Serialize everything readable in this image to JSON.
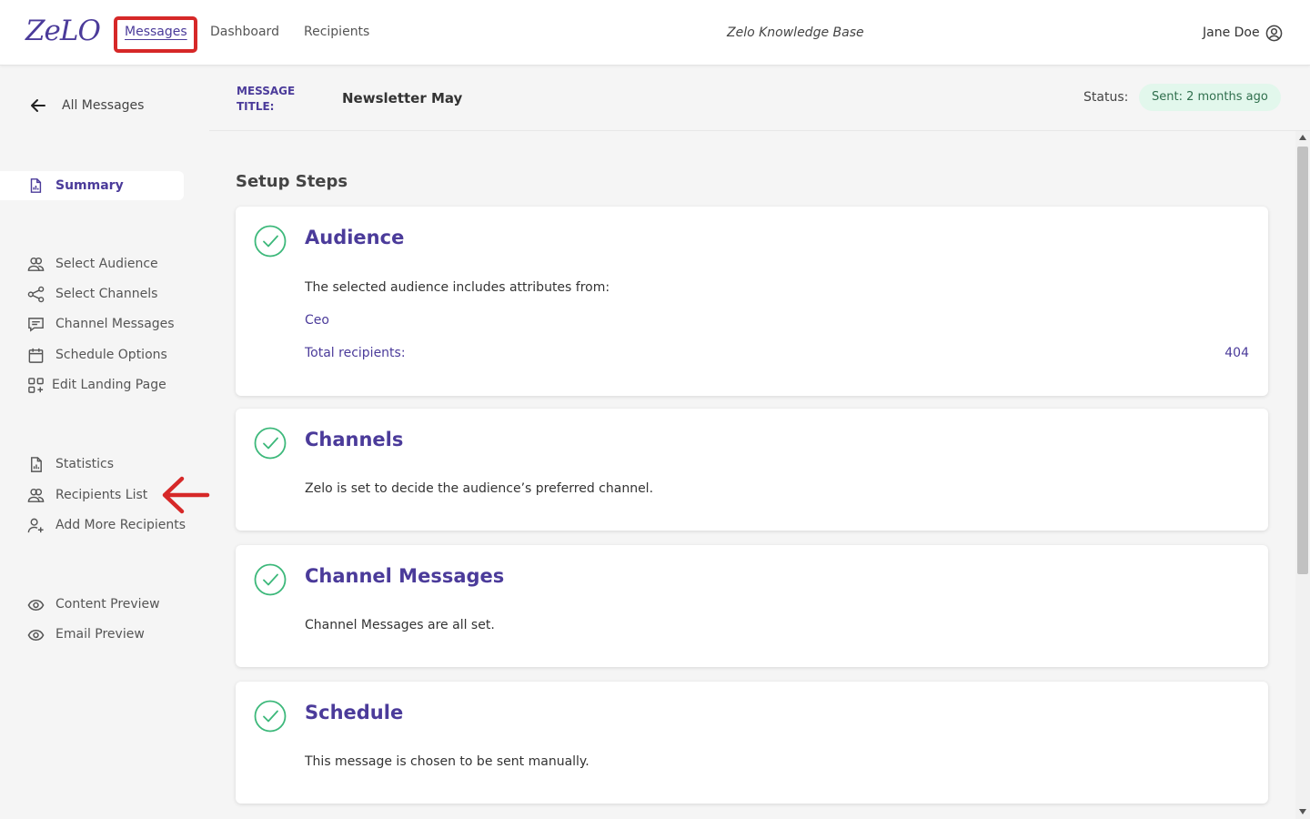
{
  "brand": {
    "logo_text": "ZeLO"
  },
  "topnav": {
    "items": [
      {
        "label": "Messages"
      },
      {
        "label": "Dashboard"
      },
      {
        "label": "Recipients"
      }
    ],
    "knowledge_base": "Zelo Knowledge Base",
    "user_name": "Jane Doe"
  },
  "sidebar": {
    "back_label": "All Messages",
    "summary_label": "Summary",
    "groups": [
      [
        {
          "label": "Select Audience",
          "icon": "users-icon"
        },
        {
          "label": "Select Channels",
          "icon": "share-icon"
        },
        {
          "label": "Channel Messages",
          "icon": "message-icon"
        },
        {
          "label": "Schedule Options",
          "icon": "calendar-icon"
        },
        {
          "label": "Edit Landing Page",
          "icon": "grid-add-icon"
        }
      ],
      [
        {
          "label": "Statistics",
          "icon": "report-icon"
        },
        {
          "label": "Recipients List",
          "icon": "users-icon"
        },
        {
          "label": "Add More Recipients",
          "icon": "user-plus-icon"
        }
      ],
      [
        {
          "label": "Content Preview",
          "icon": "eye-icon"
        },
        {
          "label": "Email Preview",
          "icon": "eye-icon"
        }
      ]
    ]
  },
  "header": {
    "title_label": "MESSAGE TITLE:",
    "title": "Newsletter May",
    "status_label": "Status:",
    "status_value": "Sent: 2 months ago"
  },
  "main": {
    "heading": "Setup Steps",
    "cards": [
      {
        "title": "Audience",
        "text": "The selected audience includes attributes from:",
        "attribute": "Ceo",
        "total_label": "Total recipients:",
        "total_value": "404"
      },
      {
        "title": "Channels",
        "text": "Zelo is set to decide the audience’s preferred channel."
      },
      {
        "title": "Channel Messages",
        "text": "Channel Messages are all set."
      },
      {
        "title": "Schedule",
        "text": "This message is chosen to be sent manually."
      }
    ]
  },
  "colors": {
    "accent": "#4b3b9a",
    "highlight": "#d62828",
    "status_bg": "#e2f7ec",
    "check": "#3cb87a"
  }
}
